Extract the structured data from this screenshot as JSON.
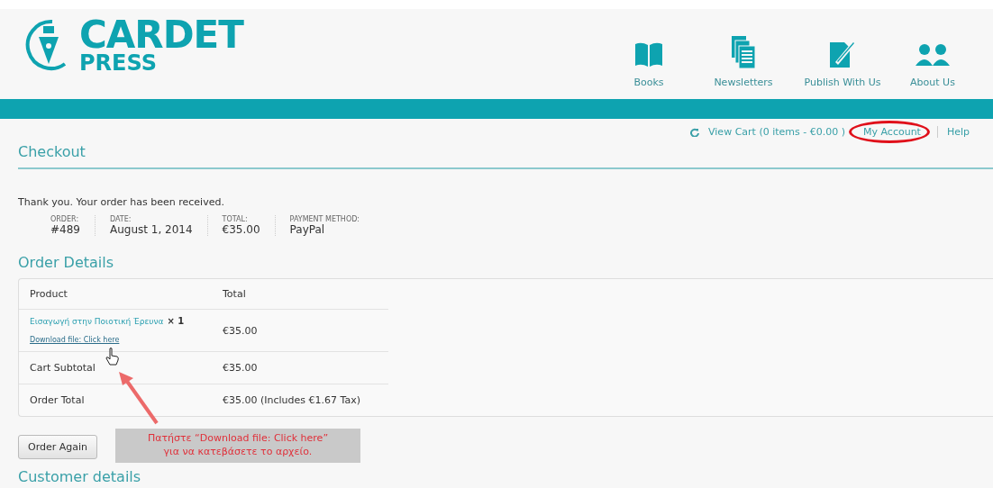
{
  "logo": {
    "name": "CARDET",
    "sub": "PRESS"
  },
  "nav": [
    {
      "label": "Books",
      "kind": "book"
    },
    {
      "label": "Newsletters",
      "kind": "pages"
    },
    {
      "label": "Publish With Us",
      "kind": "pen"
    },
    {
      "label": "About Us",
      "kind": "people"
    }
  ],
  "top_links": {
    "cart": "View Cart (0 items - €0.00 )",
    "account": "My Account",
    "help": "Help",
    "account_circled": true
  },
  "page_title": "Checkout",
  "notice": "Thank you. Your order has been received.",
  "overview": [
    {
      "label": "ORDER:",
      "value": "#489"
    },
    {
      "label": "DATE:",
      "value": "August 1, 2014"
    },
    {
      "label": "TOTAL:",
      "value": "€35.00"
    },
    {
      "label": "PAYMENT METHOD:",
      "value": "PayPal"
    }
  ],
  "order_details": {
    "title": "Order Details",
    "columns": [
      "Product",
      "Total"
    ],
    "rows": [
      {
        "kind": "product",
        "product": "Εισαγωγή στην Ποιοτική Έρευνα",
        "qty": "× 1",
        "download": "Download file: Click here",
        "total": "€35.00"
      },
      {
        "kind": "summary",
        "product": "Cart Subtotal",
        "total": "€35.00"
      },
      {
        "kind": "summary",
        "product": "Order Total",
        "total": "€35.00 (Includes €1.67 Tax)"
      }
    ]
  },
  "order_again": "Order Again",
  "callout": [
    "Πατήστε “Download file: Click here”",
    "για να κατεβάσετε το αρχείο."
  ],
  "customer_title": "Customer details"
}
